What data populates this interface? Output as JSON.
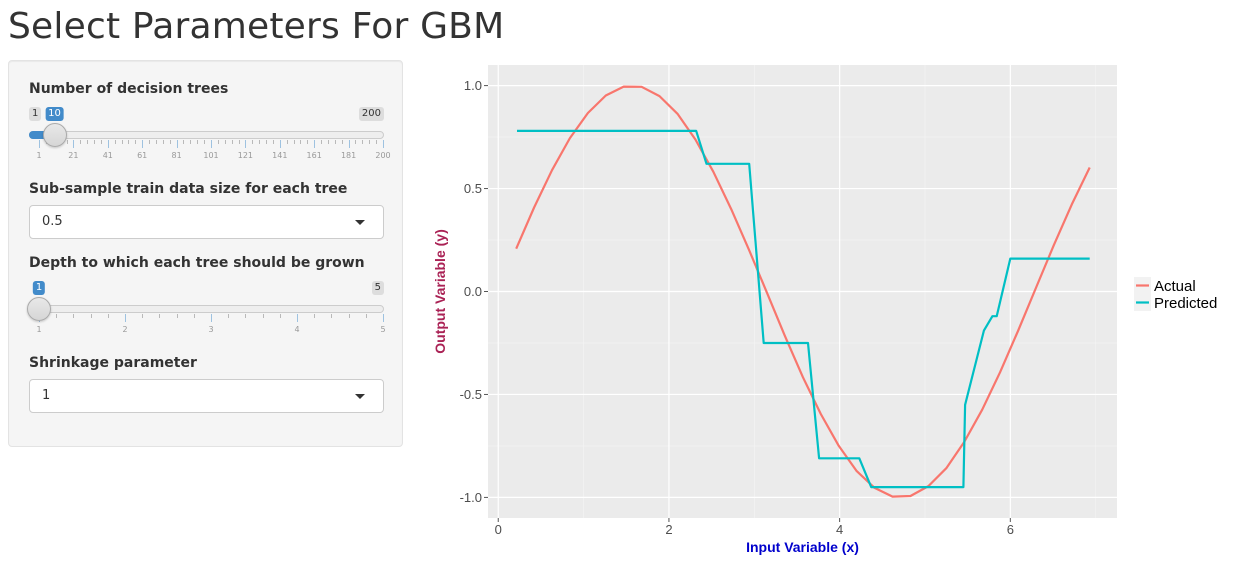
{
  "page": {
    "title": "Select Parameters For GBM"
  },
  "sidebar": {
    "num_trees": {
      "label": "Number of decision trees",
      "min": 1,
      "max": 200,
      "value": 10,
      "min_label": "1",
      "max_label": "200",
      "value_label": "10",
      "tick_labels": [
        "1",
        "21",
        "41",
        "61",
        "81",
        "101",
        "121",
        "141",
        "161",
        "181",
        "200"
      ]
    },
    "subsample": {
      "label": "Sub-sample train data size for each tree",
      "selected": "0.5"
    },
    "depth": {
      "label": "Depth to which each tree should be grown",
      "min": 1,
      "max": 5,
      "value": 1,
      "min_label": "1",
      "max_label": "5",
      "value_label": "1",
      "tick_labels": [
        "1",
        "2",
        "3",
        "4",
        "5"
      ]
    },
    "shrinkage": {
      "label": "Shrinkage parameter",
      "selected": "1"
    }
  },
  "chart_data": {
    "type": "line",
    "title": "",
    "xlabel": "Input Variable (x)",
    "ylabel": "Output Variable (y)",
    "xlim": [
      -0.12,
      7.25
    ],
    "ylim": [
      -1.1,
      1.1
    ],
    "xticks": [
      0,
      2,
      4,
      6
    ],
    "xtick_labels": [
      "0",
      "2",
      "4",
      "6"
    ],
    "yticks": [
      1.0,
      0.5,
      0.0,
      -0.5,
      -1.0
    ],
    "ytick_labels": [
      "1.0",
      "0.5",
      "0.0",
      "-0.5",
      "-1.0"
    ],
    "grid": true,
    "legend_position": "right",
    "colors": {
      "xlabel": "#0000cc",
      "ylabel": "#aa2255",
      "panel": "#ebebeb"
    },
    "series": [
      {
        "name": "Actual",
        "color": "#f8766d",
        "x": [
          0.21,
          0.42,
          0.63,
          0.84,
          1.05,
          1.26,
          1.47,
          1.68,
          1.89,
          2.1,
          2.31,
          2.52,
          2.73,
          2.94,
          3.15,
          3.36,
          3.57,
          3.78,
          3.99,
          4.2,
          4.41,
          4.62,
          4.83,
          5.04,
          5.25,
          5.46,
          5.67,
          5.88,
          6.09,
          6.3,
          6.51,
          6.72,
          6.93
        ],
        "y": [
          0.208,
          0.408,
          0.589,
          0.745,
          0.867,
          0.952,
          0.995,
          0.994,
          0.949,
          0.863,
          0.738,
          0.582,
          0.4,
          0.2,
          -0.008,
          -0.217,
          -0.416,
          -0.595,
          -0.75,
          -0.872,
          -0.954,
          -0.996,
          -0.993,
          -0.945,
          -0.858,
          -0.731,
          -0.574,
          -0.392,
          -0.192,
          0.017,
          0.225,
          0.423,
          0.602
        ]
      },
      {
        "name": "Predicted",
        "color": "#00bfc4",
        "x": [
          0.22,
          2.32,
          2.44,
          2.94,
          3.11,
          3.63,
          3.76,
          4.23,
          4.37,
          5.45,
          5.47,
          5.69,
          5.79,
          5.84,
          6.0,
          6.93
        ],
        "y": [
          0.78,
          0.78,
          0.62,
          0.62,
          -0.25,
          -0.25,
          -0.81,
          -0.81,
          -0.95,
          -0.95,
          -0.55,
          -0.19,
          -0.12,
          -0.12,
          0.16,
          0.16
        ]
      }
    ]
  }
}
